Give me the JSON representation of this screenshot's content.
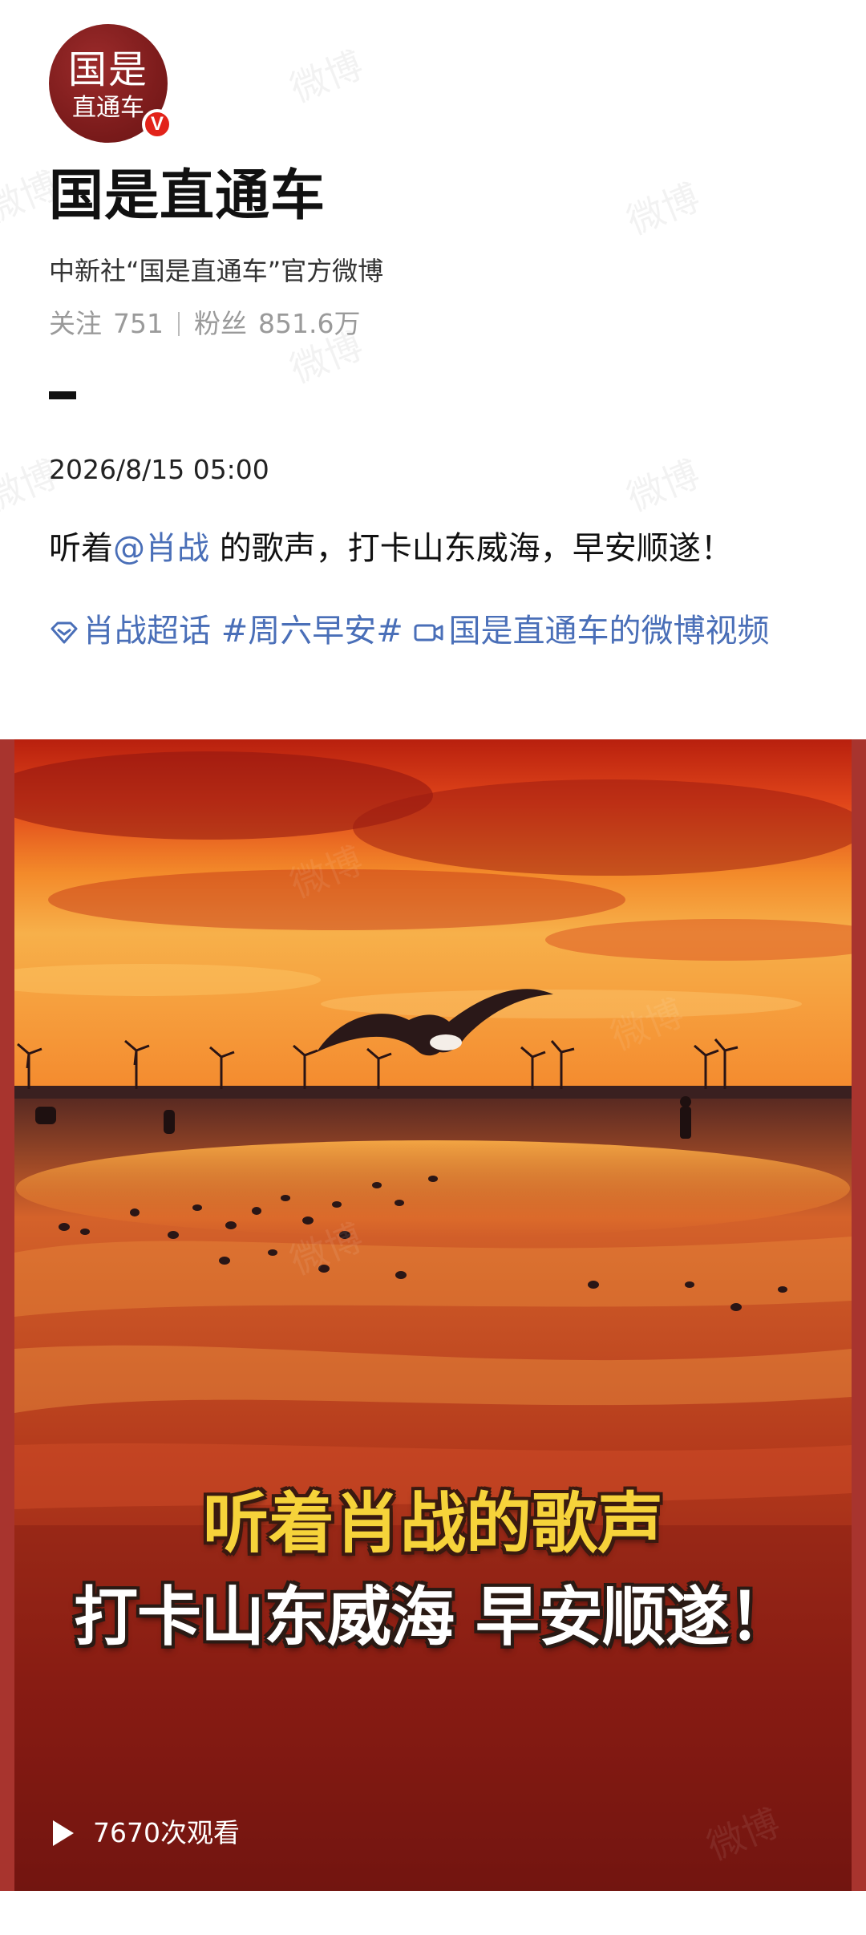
{
  "profile": {
    "avatar_text_1": "国是",
    "avatar_text_2": "直通车",
    "verified_badge": "V",
    "name": "国是直通车",
    "description": "中新社“国是直通车”官方微博",
    "following_label": "关注",
    "following_count": "751",
    "followers_label": "粉丝",
    "followers_count": "851.6万"
  },
  "post": {
    "timestamp": "2026/8/15 05:00",
    "text_before_mention": "听着",
    "mention": "@肖战",
    "text_after_mention": " 的歌声，打卡山东威海，早安顺遂！",
    "tags": [
      {
        "icon": "super-topic-icon",
        "label": "肖战超话"
      },
      {
        "icon": "",
        "label": "#周六早安#"
      },
      {
        "icon": "video-link-icon",
        "label": "国是直通车的微博视频"
      }
    ]
  },
  "video": {
    "caption_line_1": "听着肖战的歌声",
    "caption_line_2": "打卡山东威海 早安顺遂！",
    "view_count": "7670次观看"
  },
  "watermark_text": "微博",
  "colors": {
    "link": "#4a6fb8",
    "avatar_bg": "#7d1c1c",
    "verified": "#e2231a",
    "caption_yellow": "#f6d33a"
  }
}
